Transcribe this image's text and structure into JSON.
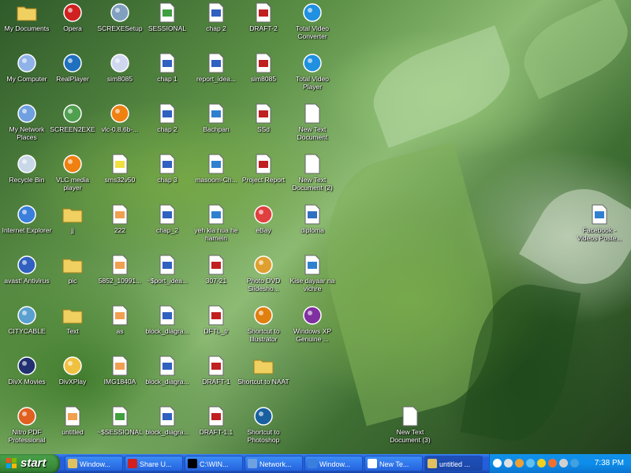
{
  "desktop_icons": [
    {
      "label": "My Documents",
      "icon": "my-documents-icon",
      "color": "#f0d060"
    },
    {
      "label": "My Computer",
      "icon": "my-computer-icon",
      "color": "#8fb3e8"
    },
    {
      "label": "My Network Places",
      "icon": "network-places-icon",
      "color": "#6fa0e0"
    },
    {
      "label": "Recycle Bin",
      "icon": "recycle-bin-icon",
      "color": "#c8d8e8"
    },
    {
      "label": "Internet Explorer",
      "icon": "internet-explorer-icon",
      "color": "#3a7fdc"
    },
    {
      "label": "avast! Antivirus",
      "icon": "avast-icon",
      "color": "#3060c0"
    },
    {
      "label": "CITYCABLE",
      "icon": "network-icon",
      "color": "#5aa0d0"
    },
    {
      "label": "DivX Movies",
      "icon": "divx-icon",
      "color": "#203070"
    },
    {
      "label": "Nitro PDF Professional",
      "icon": "nitro-pdf-icon",
      "color": "#e06020"
    },
    {
      "label": "Opera",
      "icon": "opera-icon",
      "color": "#d02020"
    },
    {
      "label": "RealPlayer",
      "icon": "realplayer-icon",
      "color": "#2070c0"
    },
    {
      "label": "SCREEN2EXE",
      "icon": "screen2exe-icon",
      "color": "#50a050"
    },
    {
      "label": "VLC media player",
      "icon": "vlc-icon",
      "color": "#f08010"
    },
    {
      "label": "jj",
      "icon": "folder-icon",
      "color": "#f0d060"
    },
    {
      "label": "pic",
      "icon": "folder-icon",
      "color": "#f0d060"
    },
    {
      "label": "Text",
      "icon": "folder-icon",
      "color": "#f0d060"
    },
    {
      "label": "DivXPlay",
      "icon": "divxplay-icon",
      "color": "#f0c040"
    },
    {
      "label": "untitled",
      "icon": "image-file-icon",
      "color": "#f0a050"
    },
    {
      "label": "SCREXESetup",
      "icon": "setup-icon",
      "color": "#80a0c0"
    },
    {
      "label": "sim8085",
      "icon": "window-app-icon",
      "color": "#d0d8f0"
    },
    {
      "label": "vlc-0.8.6b-...",
      "icon": "vlc-icon",
      "color": "#f08010"
    },
    {
      "label": "sms32v50",
      "icon": "help-file-icon",
      "color": "#f0e040"
    },
    {
      "label": "222",
      "icon": "image-file-icon",
      "color": "#f0a050"
    },
    {
      "label": "5852_10991...",
      "icon": "image-file-icon",
      "color": "#f0a050"
    },
    {
      "label": "as",
      "icon": "image-file-icon",
      "color": "#f0a050"
    },
    {
      "label": "IMG1840A",
      "icon": "image-file-icon",
      "color": "#f0a050"
    },
    {
      "label": "~$SESSIONAL",
      "icon": "excel-file-icon",
      "color": "#40a040"
    },
    {
      "label": "SESSIONAL",
      "icon": "excel-file-icon",
      "color": "#40a040"
    },
    {
      "label": "chap 1",
      "icon": "word-doc-icon",
      "color": "#3060c0"
    },
    {
      "label": "chap 2",
      "icon": "word-doc-icon",
      "color": "#3060c0"
    },
    {
      "label": "chap 3",
      "icon": "word-doc-icon",
      "color": "#3060c0"
    },
    {
      "label": "chap_2",
      "icon": "word-doc-icon",
      "color": "#3060c0"
    },
    {
      "label": "~$port_idea...",
      "icon": "word-doc-icon",
      "color": "#3060c0"
    },
    {
      "label": "block_diagra...",
      "icon": "word-doc-icon",
      "color": "#3060c0"
    },
    {
      "label": "block_diagra...",
      "icon": "word-doc-icon",
      "color": "#3060c0"
    },
    {
      "label": "block_diagra...",
      "icon": "word-doc-icon",
      "color": "#3060c0"
    },
    {
      "label": "chap 2",
      "icon": "word-doc-icon",
      "color": "#3060c0"
    },
    {
      "label": "report_idea...",
      "icon": "word-doc-icon",
      "color": "#3060c0"
    },
    {
      "label": "Bachpan",
      "icon": "media-file-icon",
      "color": "#3080d0"
    },
    {
      "label": "masoom-Ch...",
      "icon": "media-file-icon",
      "color": "#3080d0"
    },
    {
      "label": "yeh kia hua he hamein",
      "icon": "media-file-icon",
      "color": "#3080d0"
    },
    {
      "label": "307-21",
      "icon": "pdf-file-icon",
      "color": "#c02020"
    },
    {
      "label": "DFTL_tr",
      "icon": "pdf-file-icon",
      "color": "#c02020"
    },
    {
      "label": "DRAFT-1",
      "icon": "pdf-file-icon",
      "color": "#c02020"
    },
    {
      "label": "DRAFT-1.1",
      "icon": "pdf-file-icon",
      "color": "#c02020"
    },
    {
      "label": "DRAFT-2",
      "icon": "pdf-file-icon",
      "color": "#c02020"
    },
    {
      "label": "sim8085",
      "icon": "pdf-file-icon",
      "color": "#c02020"
    },
    {
      "label": "SSd",
      "icon": "pdf-file-icon",
      "color": "#c02020"
    },
    {
      "label": "Project Report",
      "icon": "pdf-file-icon",
      "color": "#c02020"
    },
    {
      "label": "eBay",
      "icon": "ebay-icon",
      "color": "#e04040"
    },
    {
      "label": "Photo DVD Slidesho...",
      "icon": "photo-dvd-icon",
      "color": "#e0a030"
    },
    {
      "label": "Shortcut to Illustrator",
      "icon": "illustrator-icon",
      "color": "#e08010"
    },
    {
      "label": "Shortcut to NAAT",
      "icon": "folder-icon",
      "color": "#f0d060"
    },
    {
      "label": "Shortcut to Photoshop",
      "icon": "photoshop-icon",
      "color": "#1a60a0"
    },
    {
      "label": "Total Video Converter",
      "icon": "total-video-icon",
      "color": "#2090e0"
    },
    {
      "label": "Total Video Player",
      "icon": "total-video-icon",
      "color": "#2090e0"
    },
    {
      "label": "New Text Document",
      "icon": "text-doc-icon",
      "color": "#ffffff"
    },
    {
      "label": "New Text Document (2)",
      "icon": "text-doc-icon",
      "color": "#ffffff"
    },
    {
      "label": "diploma",
      "icon": "font-file-icon",
      "color": "#3070c0"
    },
    {
      "label": "Kise dayaar na vichre",
      "icon": "media-file-icon",
      "color": "#3080d0"
    },
    {
      "label": "Windows XP Genuine ...",
      "icon": "winrar-icon",
      "color": "#8030a0"
    },
    {
      "label": "New Text Document (3)",
      "icon": "text-doc-icon",
      "color": "#ffffff"
    },
    {
      "label": "Facebook - Videos Poste...",
      "icon": "media-file-icon",
      "color": "#3080d0"
    }
  ],
  "taskbar": {
    "start_label": "start",
    "tasks": [
      {
        "label": "Window...",
        "icon": "windows-explorer-icon",
        "color": "#e0c060",
        "active": false
      },
      {
        "label": "Share U...",
        "icon": "opera-icon",
        "color": "#d02020",
        "active": false
      },
      {
        "label": "C:\\WIN...",
        "icon": "command-prompt-icon",
        "color": "#000000",
        "active": false
      },
      {
        "label": "Network...",
        "icon": "network-icon",
        "color": "#6fa0e0",
        "active": false
      },
      {
        "label": "Window...",
        "icon": "internet-explorer-icon",
        "color": "#3a7fdc",
        "active": false
      },
      {
        "label": "New Te...",
        "icon": "notepad-icon",
        "color": "#ffffff",
        "active": false
      },
      {
        "label": "untitled ...",
        "icon": "paint-icon",
        "color": "#e0c060",
        "active": true
      }
    ],
    "tray_icons": [
      "help-icon",
      "network-tray-icon",
      "dvd-tray-icon",
      "display-tray-icon",
      "shield-tray-icon",
      "avast-tray-icon",
      "audio-tray-icon",
      "media-tray-icon"
    ],
    "clock": "7:38 PM"
  }
}
